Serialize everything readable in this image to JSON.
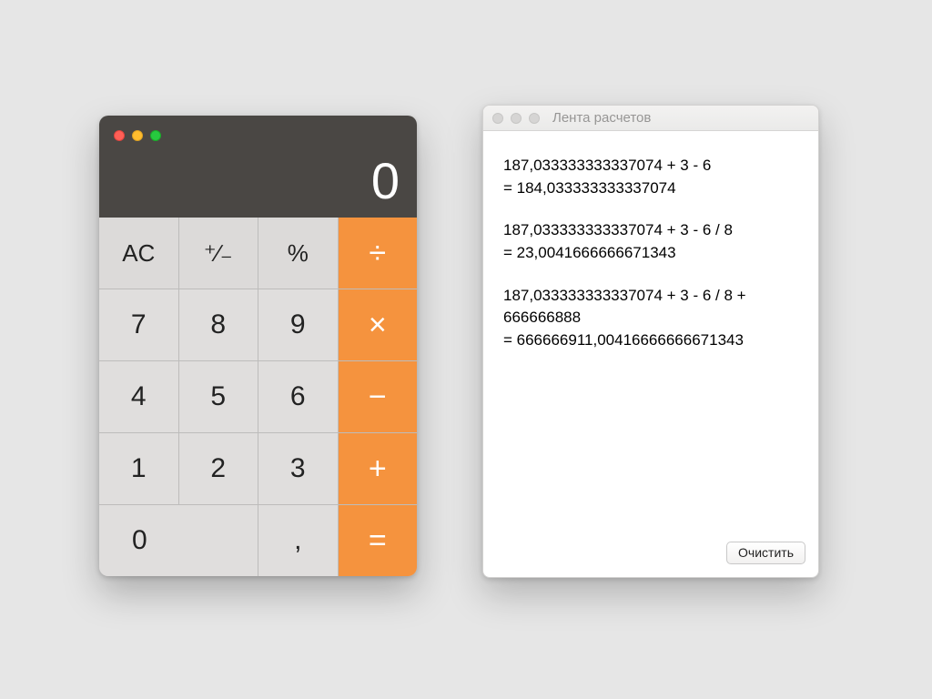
{
  "calculator": {
    "display_value": "0",
    "keys": {
      "ac": "AC",
      "plusminus": "⁺∕₋",
      "percent": "%",
      "divide": "÷",
      "seven": "7",
      "eight": "8",
      "nine": "9",
      "multiply": "×",
      "four": "4",
      "five": "5",
      "six": "6",
      "minus": "−",
      "one": "1",
      "two": "2",
      "three": "3",
      "plus": "+",
      "zero": "0",
      "decimal": ",",
      "equals": "="
    }
  },
  "tape": {
    "title": "Лента расчетов",
    "clear_label": "Очистить",
    "entries": [
      {
        "expression": "187,033333333337074 + 3 - 6",
        "result": "= 184,033333333337074"
      },
      {
        "expression": "187,033333333337074 + 3 - 6 / 8",
        "result": "= 23,0041666666671343"
      },
      {
        "expression": "187,033333333337074 + 3 - 6 / 8 + 666666888",
        "result": "= 666666911,00416666666671343"
      }
    ]
  },
  "colors": {
    "operator": "#f5933e",
    "display_bg": "#4a4744",
    "key_bg": "#e0dedd",
    "desktop": "#e6e6e6"
  }
}
